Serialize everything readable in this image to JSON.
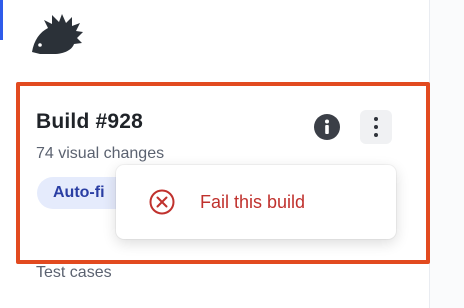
{
  "build": {
    "title": "Build #928",
    "subtitle": "74 visual changes",
    "status_badge": "Auto-fi"
  },
  "menu": {
    "fail_label": "Fail this build"
  },
  "sidebar": {
    "section_label": "Test cases"
  },
  "icons": {
    "logo": "hedgehog-logo-icon",
    "info": "info-icon",
    "more": "more-vertical-icon",
    "fail": "close-circle-icon"
  },
  "colors": {
    "highlight": "#e24a1f",
    "danger": "#c0312d",
    "badge_bg": "#e5ebfc",
    "badge_text": "#2a3ea3"
  }
}
